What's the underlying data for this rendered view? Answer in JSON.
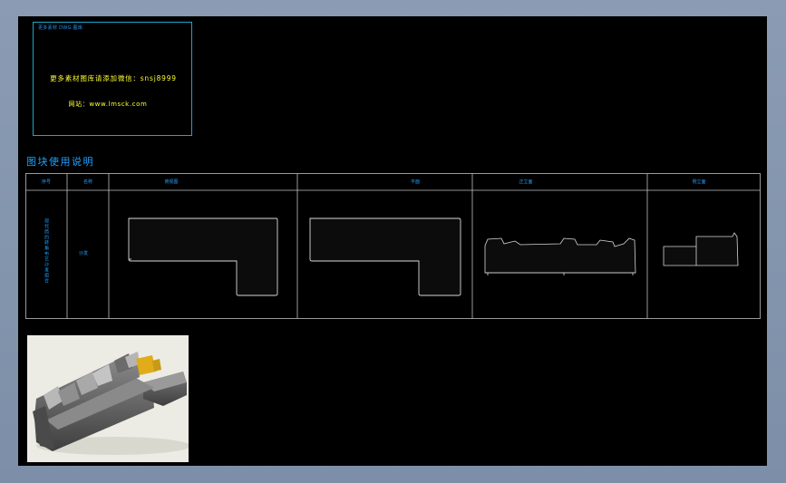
{
  "info_box": {
    "tiny_text": "更多素材 DWG 图库",
    "wechat_line": "更多素材图库请添加微信：snsj8999",
    "site_line": "网站：www.lmsck.com"
  },
  "section_title": "图块使用说明",
  "table": {
    "headers": [
      "序号",
      "名称",
      "俯视图",
      "平面",
      "正立面",
      "侧立面"
    ],
    "row": {
      "name": "现代简约转角布艺沙发组合",
      "unit": "沙发"
    }
  },
  "colors": {
    "background": "#000000",
    "cad_cyan": "#1ea0ff",
    "cad_yellow": "#ffff33",
    "line": "#c0c0c0",
    "app_frame": "#8a9bb3"
  },
  "preview_image": {
    "subject": "grey L-shaped sectional sofa with yellow cushion"
  }
}
